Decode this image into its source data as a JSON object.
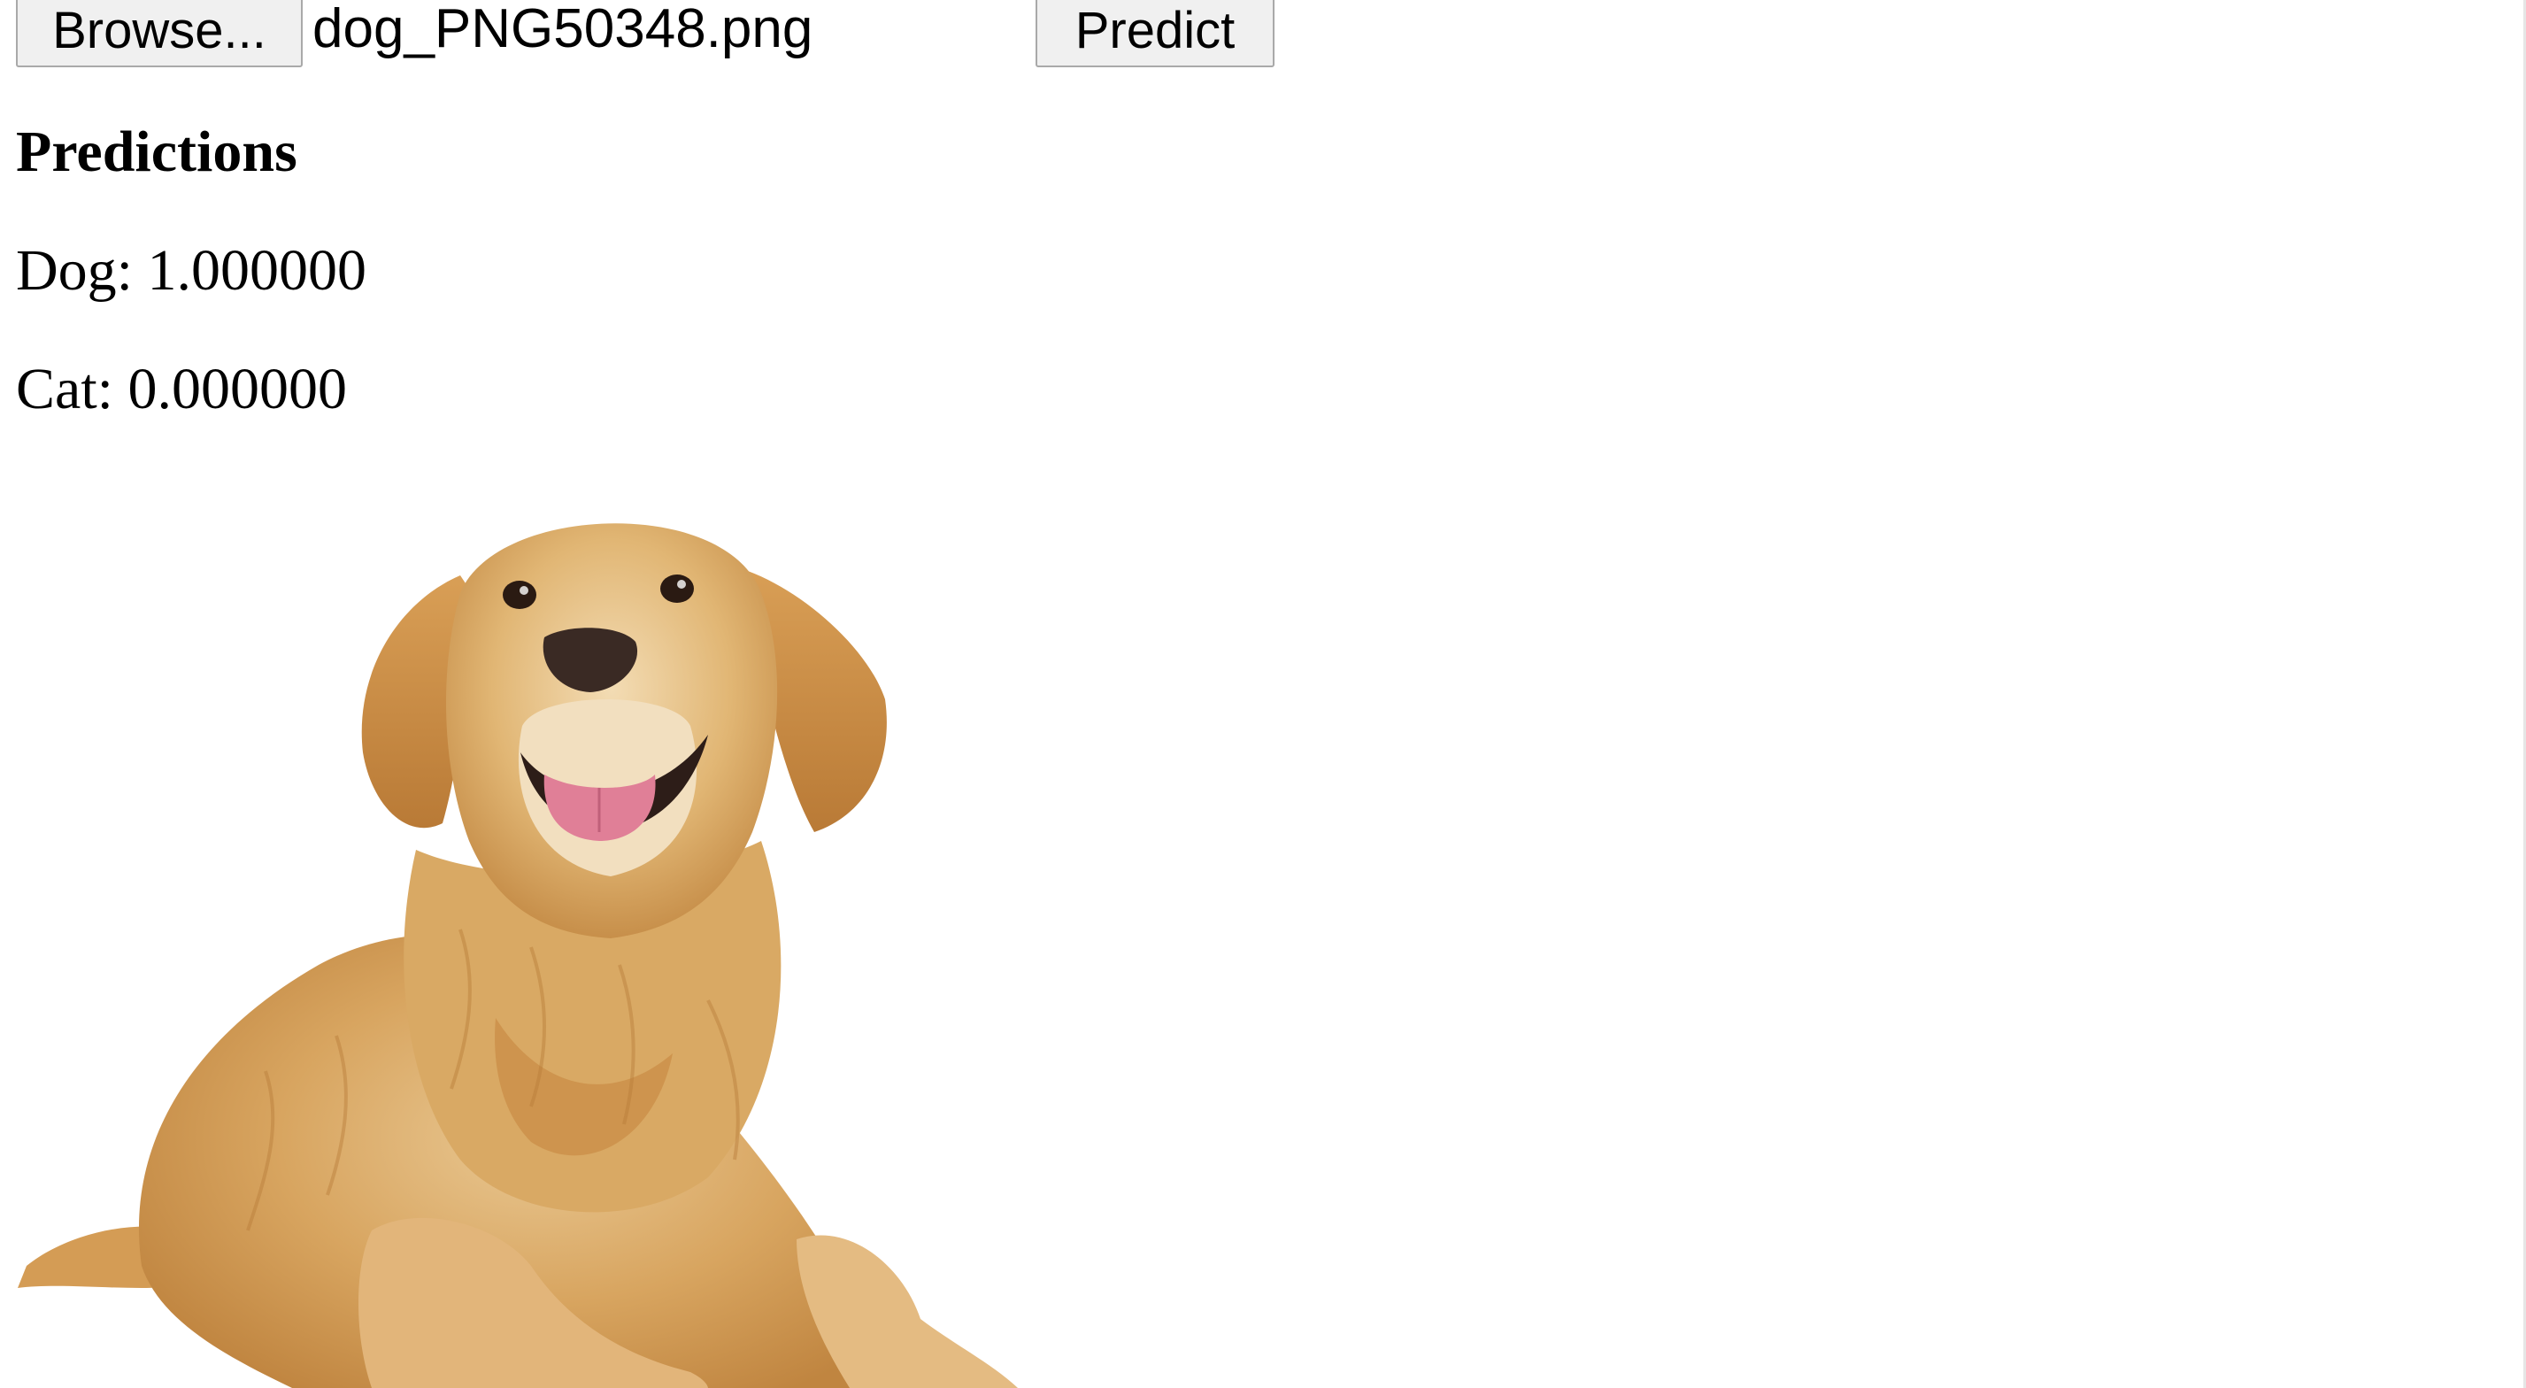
{
  "upload": {
    "browse_label": "Browse...",
    "file_name": "dog_PNG50348.png",
    "predict_label": "Predict"
  },
  "predictions": {
    "heading": "Predictions",
    "items": [
      {
        "label": "Dog: 1.000000"
      },
      {
        "label": "Cat: 0.000000"
      }
    ]
  },
  "image": {
    "subject": "golden retriever lying down",
    "colors": {
      "fur_light": "#e8c48c",
      "fur_mid": "#d4a05a",
      "fur_dark": "#b97d3a",
      "tongue": "#e07f97",
      "nose": "#3a2a24"
    }
  }
}
